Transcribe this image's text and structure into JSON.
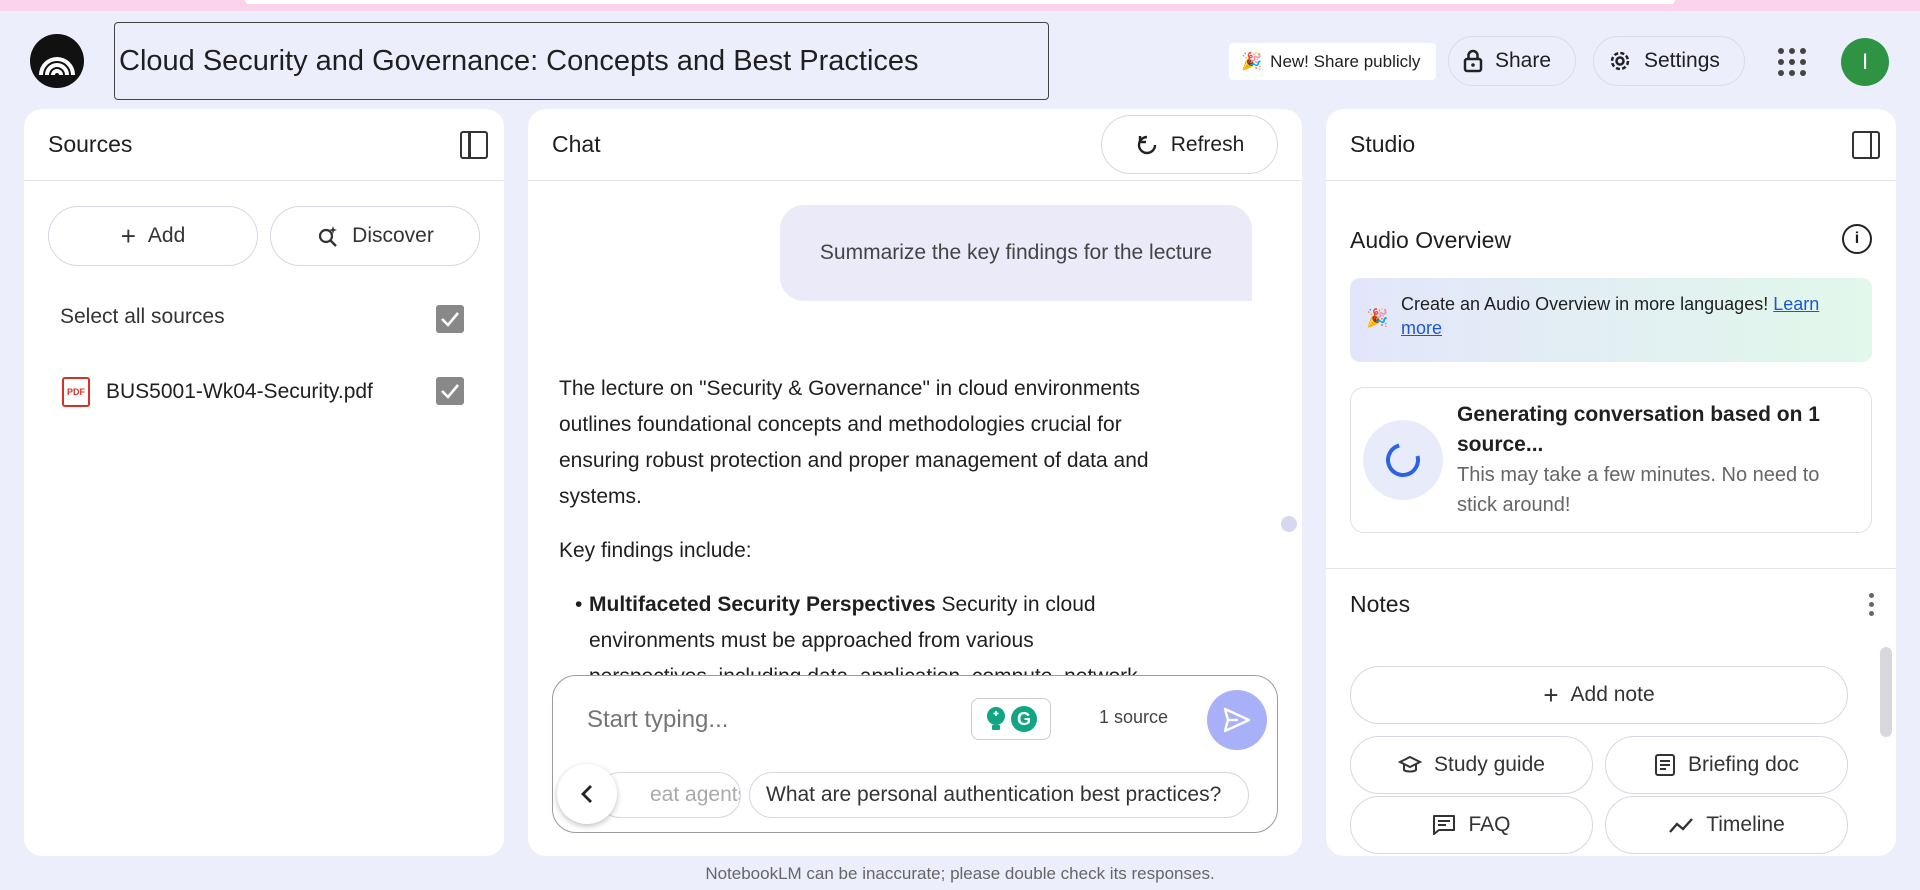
{
  "header": {
    "notebook_title": "Cloud Security and Governance: Concepts and Best Practices",
    "share_publicly_label": "New! Share publicly",
    "share_label": "Share",
    "settings_label": "Settings",
    "avatar_initial": "I"
  },
  "sources": {
    "title": "Sources",
    "add_label": "Add",
    "discover_label": "Discover",
    "select_all_label": "Select all sources",
    "items": [
      {
        "name": "BUS5001-Wk04-Security.pdf",
        "icon": "pdf-icon",
        "checked": true
      }
    ]
  },
  "chat": {
    "title": "Chat",
    "refresh_label": "Refresh",
    "user_message": "Summarize the key findings for the lecture",
    "answer_intro": "The lecture on \"Security & Governance\" in cloud environments outlines foundational concepts and methodologies crucial for ensuring robust protection and proper management of data and systems.",
    "key_findings_label": "Key findings include:",
    "bullets": [
      {
        "heading": "Multifaceted Security Perspectives",
        "text": " Security in cloud environments must be approached from various perspectives, including data, application, compute, network"
      }
    ],
    "composer": {
      "placeholder": "Start typing...",
      "source_count": "1 source",
      "suggestions": [
        "eat agents.",
        "What are personal authentication best practices?"
      ]
    }
  },
  "studio": {
    "title": "Studio",
    "audio_overview_title": "Audio Overview",
    "promo_text": "Create an Audio Overview in more languages!",
    "promo_link": "Learn more",
    "generating_title": "Generating conversation based on 1 source...",
    "generating_subtitle": "This may take a few minutes. No need to stick around!",
    "notes_title": "Notes",
    "add_note_label": "Add note",
    "buttons": {
      "study_guide": "Study guide",
      "briefing_doc": "Briefing doc",
      "faq": "FAQ",
      "timeline": "Timeline"
    }
  },
  "footer_text": "NotebookLM can be inaccurate; please double check its responses."
}
